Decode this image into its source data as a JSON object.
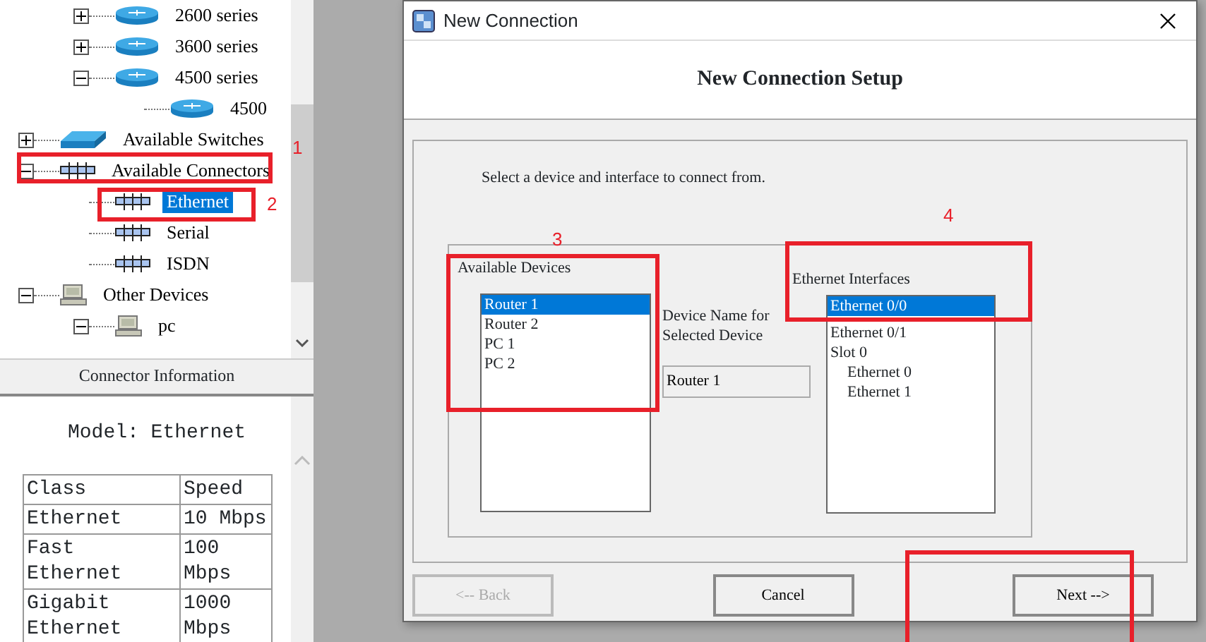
{
  "tree": {
    "partial_branch": [
      {
        "label": "2600 series",
        "kind": "router",
        "expanded": false,
        "selected": false
      },
      {
        "label": "3600 series",
        "kind": "router",
        "expanded": false,
        "selected": false
      },
      {
        "label": "4500 series",
        "kind": "router",
        "expanded": true,
        "selected": false,
        "children": [
          {
            "label": "4500",
            "kind": "router",
            "selected": false
          }
        ]
      }
    ],
    "items": [
      {
        "label": "Available Switches",
        "kind": "switch",
        "expanded": false,
        "selected": false
      },
      {
        "label": "Available Connectors",
        "kind": "connector",
        "expanded": true,
        "selected": false,
        "children": [
          {
            "label": "Ethernet",
            "kind": "connector",
            "selected": true
          },
          {
            "label": "Serial",
            "kind": "connector",
            "selected": false
          },
          {
            "label": "ISDN",
            "kind": "connector",
            "selected": false
          }
        ]
      },
      {
        "label": "Other Devices",
        "kind": "pc",
        "expanded": true,
        "selected": false,
        "children": [
          {
            "label": "pc",
            "kind": "pc",
            "expanded": true,
            "selected": false
          }
        ]
      }
    ]
  },
  "info_panel": {
    "title": "Connector Information",
    "model": "Model: Ethernet",
    "table": {
      "columns": [
        "Class",
        "Speed"
      ],
      "rows": [
        [
          "Ethernet",
          "10 Mbps"
        ],
        [
          "Fast Ethernet",
          "100 Mbps"
        ],
        [
          "Gigabit Ethernet",
          "1000 Mbps"
        ]
      ]
    }
  },
  "dialog": {
    "title": "New Connection",
    "heading": "New Connection Setup",
    "instruction": "Select a device and interface to connect from.",
    "devices": {
      "label": "Available Devices",
      "items": [
        {
          "label": "Router 1",
          "selected": true
        },
        {
          "label": "Router 2",
          "selected": false
        },
        {
          "label": "PC 1",
          "selected": false
        },
        {
          "label": "PC 2",
          "selected": false
        }
      ]
    },
    "device_name": {
      "label": "Device Name for Selected Device",
      "value": "Router 1"
    },
    "interfaces": {
      "label": "Ethernet Interfaces",
      "items": [
        {
          "label": "Ethernet 0/0",
          "selected": true
        },
        {
          "label": "Ethernet 0/1",
          "selected": false
        },
        {
          "label": "Slot 0",
          "selected": false,
          "children": [
            {
              "label": "Ethernet 0",
              "selected": false
            },
            {
              "label": "Ethernet 1",
              "selected": false
            }
          ]
        }
      ]
    },
    "buttons": [
      {
        "label": "<-- Back",
        "disabled": true
      },
      {
        "label": "Cancel",
        "disabled": false
      },
      {
        "label": "Next -->",
        "disabled": false
      }
    ]
  },
  "markups": [
    {
      "kind": "numbered",
      "label": "1"
    },
    {
      "kind": "numbered",
      "label": "2"
    },
    {
      "kind": "numbered",
      "label": "3"
    },
    {
      "kind": "numbered",
      "label": "4"
    },
    {
      "kind": "plain"
    }
  ]
}
